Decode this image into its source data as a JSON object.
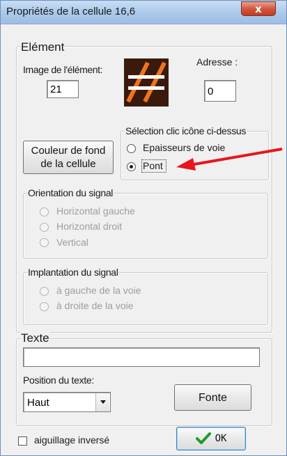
{
  "window": {
    "title": "Propriétés de la cellule 16,6",
    "close_label": "x"
  },
  "element_group": {
    "legend": "Elément",
    "image_label": "Image de l'élément:",
    "image_value": "21",
    "address_label": "Adresse :",
    "address_value": "0",
    "color_button": "Couleur de fond de la cellule",
    "icon_name": "bridge-track-icon",
    "icon_colors": {
      "background": "#3a1a0c",
      "stripes": "#f0741e",
      "rails": "#ffffff"
    }
  },
  "selection_group": {
    "legend": "Sélection clic icône ci-dessus",
    "options": [
      {
        "label": "Epaisseurs de voie",
        "checked": false
      },
      {
        "label": "Pont",
        "checked": true
      }
    ]
  },
  "annotation": {
    "arrow_color": "#e8161b"
  },
  "orientation_group": {
    "legend": "Orientation du signal",
    "options": [
      "Horizontal gauche",
      "Horizontal droit",
      "Vertical"
    ]
  },
  "implantation_group": {
    "legend": "Implantation du signal",
    "options": [
      "à gauche de la voie",
      "à droite de la voie"
    ]
  },
  "text_group": {
    "legend": "Texte",
    "text_value": "",
    "position_label": "Position du texte:",
    "position_value": "Haut",
    "font_button": "Fonte"
  },
  "footer": {
    "checkbox_label": "aiguillage inversé",
    "checkbox_checked": false,
    "ok_label": "OK",
    "ok_icon": "checkmark-icon"
  }
}
